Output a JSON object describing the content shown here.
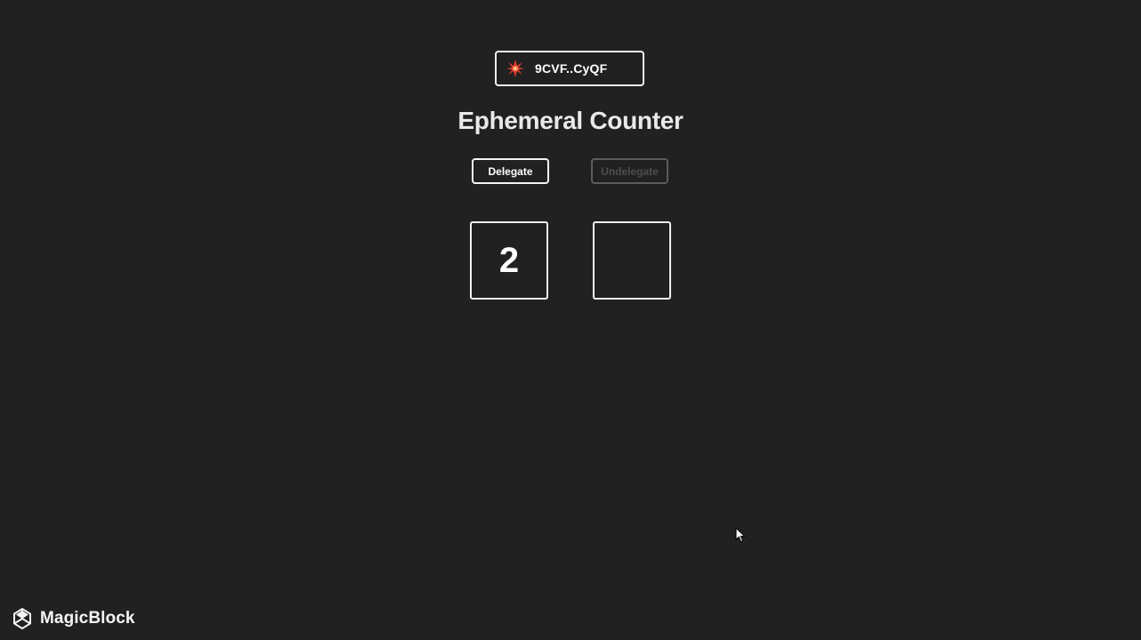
{
  "wallet": {
    "icon": "wallet-avatar-icon",
    "address": "9CVF..CyQF"
  },
  "title": "Ephemeral Counter",
  "actions": {
    "delegate_label": "Delegate",
    "undelegate_label": "Undelegate",
    "undelegate_disabled": true
  },
  "counters": {
    "left_value": "2",
    "right_value": ""
  },
  "footer": {
    "logo_icon": "magicblock-logo-icon",
    "brand_name": "MagicBlock"
  },
  "colors": {
    "background": "#212121",
    "text": "#ffffff",
    "border": "#f0f0f0",
    "disabled": "#5c5c5c",
    "wallet_icon_red": "#e23a2a"
  }
}
